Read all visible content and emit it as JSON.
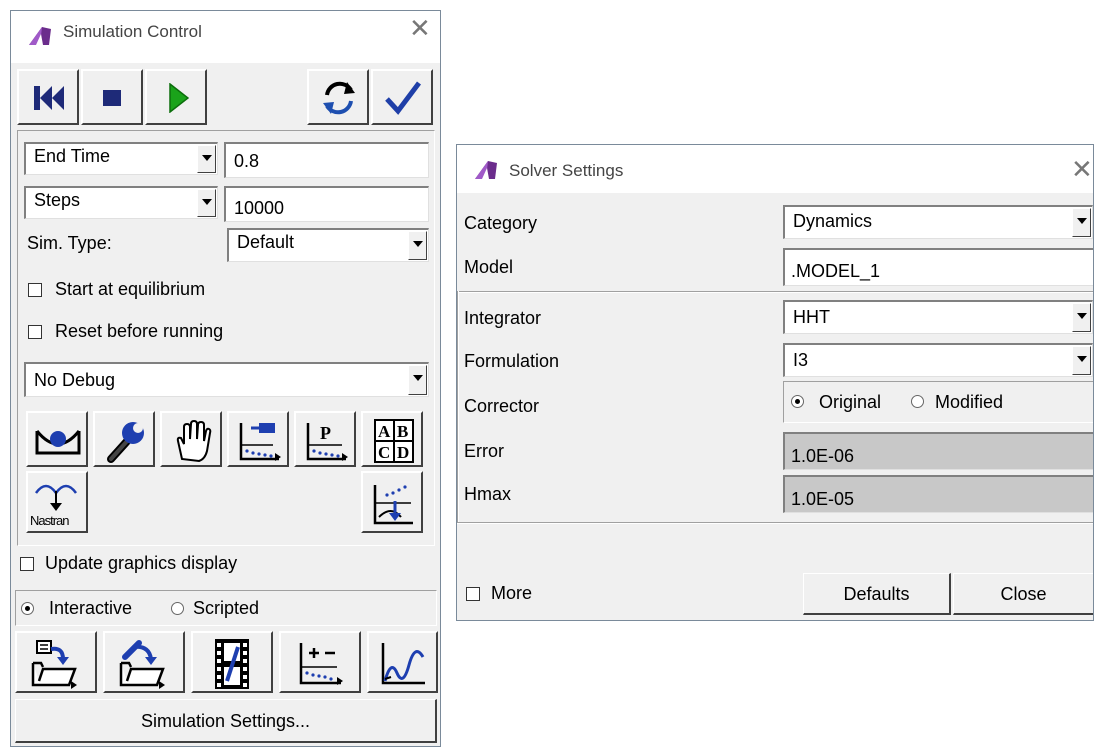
{
  "sim_control": {
    "title": "Simulation Control",
    "toolbar": {
      "rewind_icon": "rewind-icon",
      "stop_icon": "stop-icon",
      "play_icon": "play-icon",
      "reset_icon": "reset-icon",
      "ok_icon": "check-icon",
      "play_color": "#1aa31a",
      "check_color": "#1f3fa8"
    },
    "end_time_select": "End Time",
    "end_time_value": "0.8",
    "steps_select": "Steps",
    "steps_value": "10000",
    "sim_type_label": "Sim. Type:",
    "sim_type_value": "Default",
    "start_equilibrium_label": "Start at equilibrium",
    "reset_before_label": "Reset before running",
    "debug_value": "No Debug",
    "tools_row1": [
      "equilibrium-icon",
      "wrench-icon",
      "hand-icon",
      "sensor-plot-icon",
      "parameter-plot-icon",
      "abcd-table-icon"
    ],
    "abcd_letters": [
      "A",
      "B",
      "C",
      "D"
    ],
    "nastran_label": "Nastran",
    "p_letter": "P",
    "update_graphics_label": "Update graphics display",
    "mode_interactive": "Interactive",
    "mode_scripted": "Scripted",
    "tools_row2": [
      "import-script-icon",
      "edit-script-icon",
      "animation-film-icon",
      "measures-plot-icon",
      "postprocessor-plot-icon"
    ],
    "settings_button": "Simulation Settings..."
  },
  "solver": {
    "title": "Solver Settings",
    "category_label": "Category",
    "category_value": "Dynamics",
    "model_label": "Model",
    "model_value": ".MODEL_1",
    "integrator_label": "Integrator",
    "integrator_value": "HHT",
    "formulation_label": "Formulation",
    "formulation_value": "I3",
    "corrector_label": "Corrector",
    "corrector_original": "Original",
    "corrector_modified": "Modified",
    "error_label": "Error",
    "error_value": "1.0E-06",
    "hmax_label": "Hmax",
    "hmax_value": "1.0E-05",
    "more_label": "More",
    "defaults_button": "Defaults",
    "close_button": "Close"
  },
  "close_glyph": "✕"
}
